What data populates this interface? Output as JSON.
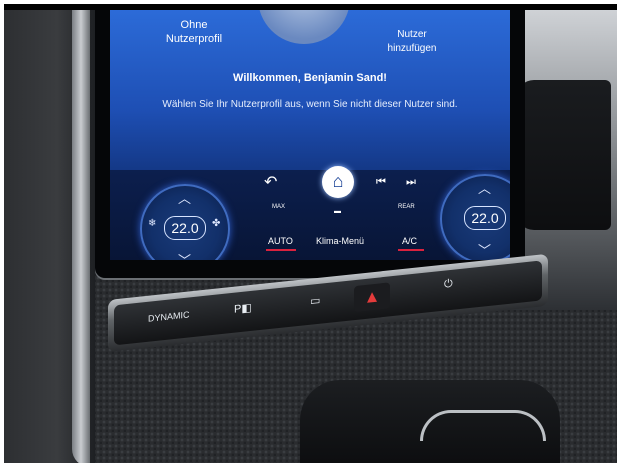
{
  "profiles": {
    "left_label": "Ohne\nNutzerprofil",
    "right_label": "Nutzer\nhinzufügen"
  },
  "welcome": {
    "title": "Willkommen, Benjamin Sand!",
    "subtitle": "Wählen Sie Ihr Nutzerprofil aus, wenn Sie nicht dieser Nutzer sind."
  },
  "climate": {
    "left_temp": "22.0",
    "right_temp": "22.0",
    "auto_label": "AUTO",
    "klima_label": "Klima-Menü",
    "ac_label": "A/C",
    "max_label": "MAX",
    "rear_label": "REAR",
    "accent_color": "#d9223e"
  },
  "strip": {
    "dynamic_label": "DYNAMIC"
  },
  "icons": {
    "back": "↶",
    "home": "⌂",
    "prev": "⏮",
    "next": "⏭",
    "fan": "✤",
    "snow": "❄",
    "hazard": "▲",
    "power": "⏻",
    "up": "︿",
    "down": "﹀"
  }
}
